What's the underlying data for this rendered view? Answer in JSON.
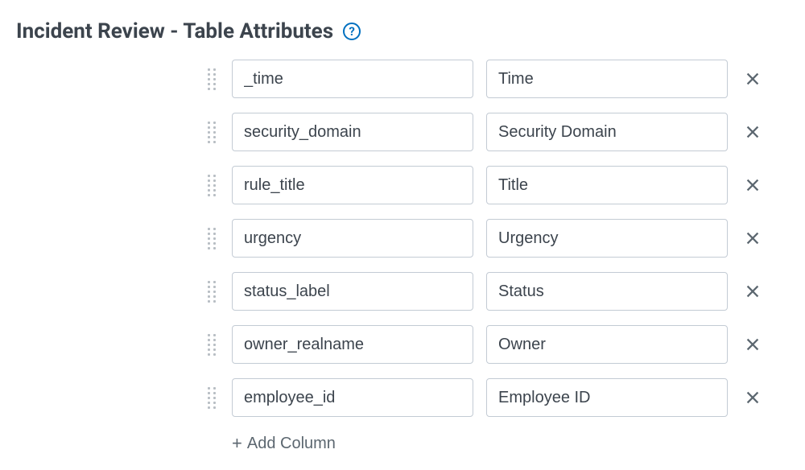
{
  "header": {
    "title": "Incident Review - Table Attributes",
    "help_icon": "?"
  },
  "rows": [
    {
      "field": "_time",
      "label": "Time"
    },
    {
      "field": "security_domain",
      "label": "Security Domain"
    },
    {
      "field": "rule_title",
      "label": "Title"
    },
    {
      "field": "urgency",
      "label": "Urgency"
    },
    {
      "field": "status_label",
      "label": "Status"
    },
    {
      "field": "owner_realname",
      "label": "Owner"
    },
    {
      "field": "employee_id",
      "label": "Employee ID"
    }
  ],
  "add_column_label": "Add Column"
}
